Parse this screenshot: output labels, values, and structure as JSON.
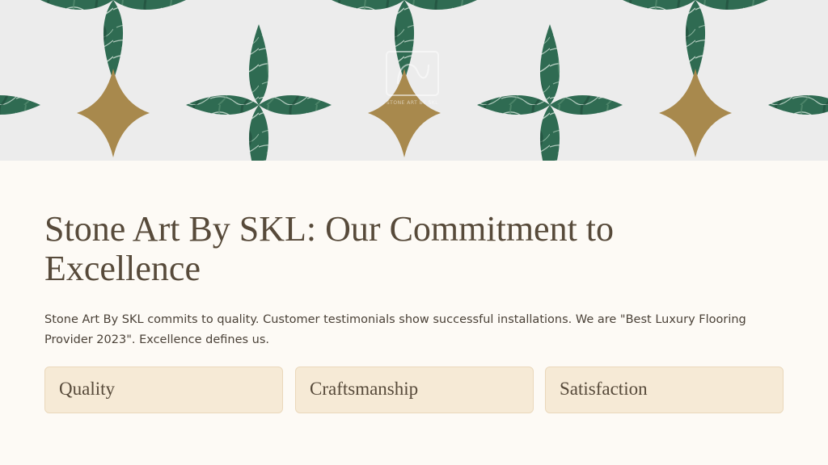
{
  "banner": {
    "watermark_text": "STONE ART BY SKL",
    "colors": {
      "background": "#ececec",
      "marble_green": "#2f6b52",
      "gold_star": "#a8894d"
    }
  },
  "main": {
    "title": "Stone Art By SKL: Our Commitment to Excellence",
    "body": "Stone Art By SKL commits to quality. Customer testimonials show successful installations. We are \"Best Luxury Flooring Provider 2023\". Excellence defines us.",
    "cards": [
      {
        "label": "Quality"
      },
      {
        "label": "Craftsmanship"
      },
      {
        "label": "Satisfaction"
      }
    ]
  },
  "colors": {
    "page_background": "#fdfaf5",
    "heading": "#574a3a",
    "card_background": "#f6ead6",
    "card_border": "#ead8bb"
  }
}
